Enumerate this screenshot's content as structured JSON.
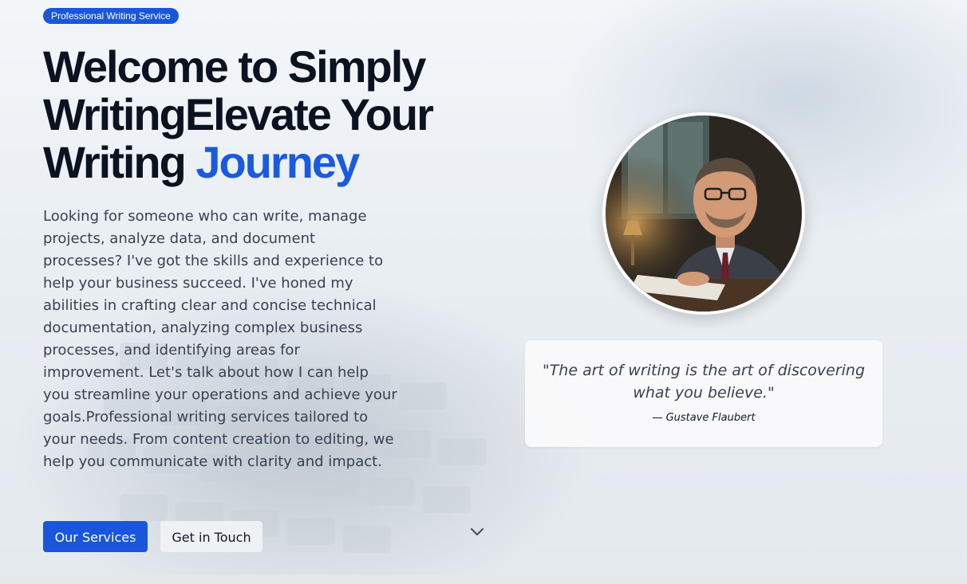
{
  "hero": {
    "badge": "Professional Writing Service",
    "title_main": "Welcome to Simply WritingElevate Your Writing ",
    "title_accent": "Journey",
    "description": "Looking for someone who can write, manage projects, analyze data, and document processes? I've got the skills and experience to help your business succeed. I've honed my abilities in crafting clear and concise technical documentation, analyzing complex business processes, and identifying areas for improvement. Let's talk about how I can help you streamline your operations and achieve your goals.Professional writing services tailored to your needs. From content creation to editing, we help you communicate with clarity and impact.",
    "primary_button": "Our Services",
    "secondary_button": "Get in Touch",
    "scroll_icon": "chevron-down-icon"
  },
  "profile": {
    "avatar_icon": "portrait-photo"
  },
  "quote": {
    "text": "\"The art of writing is the art of discovering what you believe.\"",
    "author": "— Gustave Flaubert"
  },
  "colors": {
    "accent": "#1a5ae0",
    "button_primary": "#1a56db",
    "heading": "#0b1220",
    "body_text": "#374151"
  }
}
